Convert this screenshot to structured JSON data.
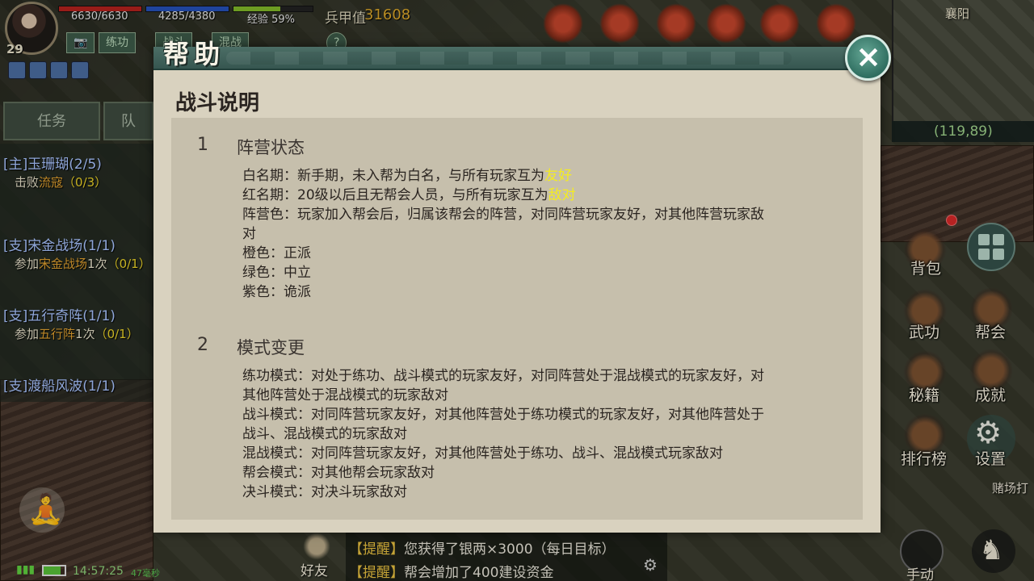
{
  "hud": {
    "level": "29",
    "hp": "6630/6630",
    "mp": "4285/4380",
    "xp": "经验 59%",
    "xp_fraction": 0.59,
    "power_label": "兵甲值",
    "power_value": "31608",
    "buttons": [
      "练功",
      "战斗",
      "混战",
      "?"
    ]
  },
  "minimap": {
    "city": "襄阳",
    "coords": "(119,89)"
  },
  "quest_tabs": [
    "任务",
    "队"
  ],
  "quests": [
    {
      "title": "[主]玉珊瑚(2/5)",
      "desc_prefix": "击败",
      "desc_target": "流寇",
      "desc_suffix": "",
      "count": "（0/3）"
    },
    {
      "title": "[支]宋金战场(1/1)",
      "desc_prefix": "参加",
      "desc_target": "宋金战场",
      "desc_suffix": "1次",
      "count": "（0/1）"
    },
    {
      "title": "[支]五行奇阵(1/1)",
      "desc_prefix": "参加",
      "desc_target": "五行阵",
      "desc_suffix": "1次",
      "count": "（0/1）"
    },
    {
      "title": "[支]渡船风波(1/1)"
    }
  ],
  "status": {
    "time": "14:57:25",
    "ping": "47毫秒"
  },
  "chat": {
    "friends": "好友",
    "tag": "【提醒】",
    "lines": [
      "您获得了银两×3000（每日目标）",
      "帮会增加了400建设资金"
    ]
  },
  "right_menu": {
    "bag": "背包",
    "martial": "武功",
    "guild": "帮会",
    "secrets": "秘籍",
    "achievements": "成就",
    "ranking": "排行榜",
    "settings": "设置",
    "gamble": "赌场打",
    "manual": "手动"
  },
  "modal": {
    "title": "帮助",
    "close": "×",
    "section_title": "战斗说明",
    "sections": [
      {
        "num": "1",
        "heading": "阵营状态",
        "lines": {
          "white_pre": "白名期：新手期，未入帮为白名，与所有玩家互为",
          "white_hl": "友好",
          "red_pre": "红名期：20级以后且无帮会人员，与所有玩家互为",
          "red_hl": "敌对",
          "camp_color_1": "阵营色：玩家加入帮会后，归属该帮会的阵营，对同阵营玩家友好，对其他阵营玩家敌",
          "camp_color_2": "对",
          "orange": "橙色：正派",
          "green": "绿色：中立",
          "purple": "紫色：诡派"
        }
      },
      {
        "num": "2",
        "heading": "模式变更",
        "lines": [
          "练功模式：对处于练功、战斗模式的玩家友好，对同阵营处于混战模式的玩家友好，对",
          "其他阵营处于混战模式的玩家敌对",
          "战斗模式：对同阵营玩家友好，对其他阵营处于练功模式的玩家友好，对其他阵营处于",
          "战斗、混战模式的玩家敌对",
          "混战模式：对同阵营玩家友好，对其他阵营处于练功、战斗、混战模式玩家敌对",
          "帮会模式：对其他帮会玩家敌对",
          "决斗模式：对决斗玩家敌对"
        ]
      }
    ]
  },
  "colors": {
    "highlight": "#f4ec20",
    "modal_bg": "#d9d2bf",
    "header": "#365650",
    "close_btn": "#2f6e60"
  }
}
